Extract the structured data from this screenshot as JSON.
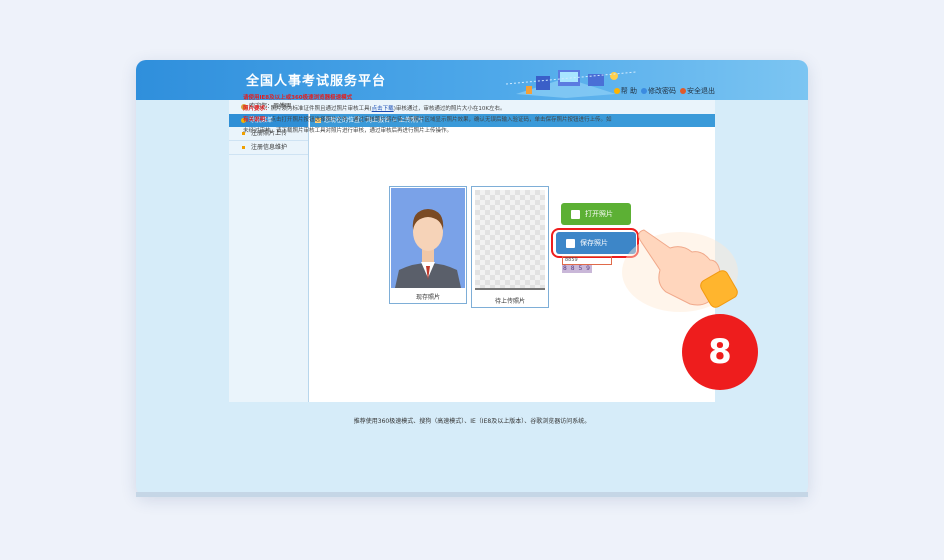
{
  "header": {
    "app_title": "全国人事考试服务平台",
    "links": [
      "帮 助",
      "修改密码",
      "安全退出"
    ],
    "link_icons": [
      "help-icon",
      "key-icon",
      "logout-icon"
    ]
  },
  "welcome": {
    "text": "欢迎您：周傅明"
  },
  "sidebar": {
    "header": "导航菜单",
    "items": [
      "注册照片上传",
      "注册信息维护"
    ]
  },
  "breadcrumb": {
    "text": "您现在的位置：网上报名 > 上传照片"
  },
  "notes": {
    "title": "请使用IE8及以上或360极速浏览器极速模式",
    "req_label": "照片要求：",
    "req_text_1": "照片须为标准证件照且通过照片审核工具(",
    "req_link": "点击下载",
    "req_text_2": ")审核通过，审核通过的照片大小在10K左右。",
    "desc_label": "有关说明：",
    "desc_text": "点击打开照片按钮选择照片文件，通过审核照片将在待上传照片区域显示照片效果，确认无误后输入验证码，单击保存照片按钮进行上传。如未经过审核，请下载照片审核工具对照片进行审核，通过审核后再进行照片上传操作。"
  },
  "photos": {
    "current_caption": "现存照片",
    "pending_caption": "待上传照片"
  },
  "buttons": {
    "open": "打开照片",
    "save": "保存照片"
  },
  "captcha": {
    "input_value": "8859",
    "image_text": "8 8 5 9"
  },
  "footer": {
    "text": "推荐使用360极速模式、搜狗（高速模式）、IE（IE8及以上版本）、谷歌浏览器访问系统。"
  },
  "step_badge": "8",
  "colors": {
    "banner": "#2f8fdc",
    "accent_red": "#ee1d1d",
    "open_button": "#5cb034",
    "save_button": "#3d86c8",
    "note_red": "#e02020"
  }
}
